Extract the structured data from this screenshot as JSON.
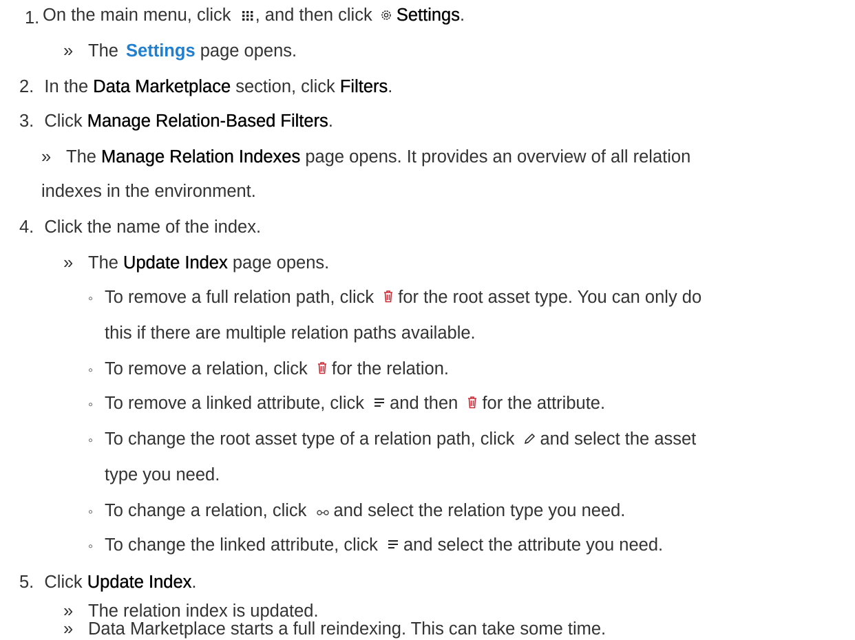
{
  "steps": [
    {
      "number": "1.",
      "text_a": "On the main menu, click",
      "text_b": ", and then click",
      "settings_label": "Settings",
      "period": ".",
      "result_marker": "»",
      "result_a": "The",
      "result_link": "Settings",
      "result_b": "page opens."
    },
    {
      "number": "2.",
      "text_a": "In the",
      "bold_1": "Data Marketplace",
      "text_b": "section, click",
      "bold_2": "Filters",
      "period": "."
    },
    {
      "number": "3.",
      "text_a": "Click",
      "bold_1": "Manage Relation-Based Filters",
      "period": ".",
      "result_marker": "»",
      "result_a": "The",
      "result_bold": "Manage Relation Indexes",
      "result_b": "page opens. It provides an overview of all relation",
      "result_c": "indexes in the environment."
    },
    {
      "number": "4.",
      "text_a": "Click the name of the index.",
      "result_marker": "»",
      "result_a": "The",
      "result_bold": "Update Index",
      "result_b": "page opens.",
      "bullet": "◦",
      "sub": [
        {
          "a": "To remove a full relation path, click",
          "b": "for the root asset type. You can only do",
          "c": "this if there are multiple relation paths available."
        },
        {
          "a": "To remove a relation, click",
          "b": "for the relation."
        },
        {
          "a": "To remove a linked attribute, click",
          "b": "and then",
          "c": "for the attribute."
        },
        {
          "a": "To change the root asset type of a relation path, click",
          "b": "and select the asset",
          "c": "type you need."
        },
        {
          "a": "To change a relation, click",
          "b": "and select the relation type you need."
        },
        {
          "a": "To change the linked attribute, click",
          "b": "and select the attribute you need."
        }
      ]
    },
    {
      "number": "5.",
      "text_a": "Click",
      "bold_1": "Update Index",
      "period": ".",
      "result_marker": "»",
      "result_1": "The relation index is updated.",
      "result_2": "Data Marketplace starts a full reindexing. This can take some time."
    }
  ],
  "icons": {
    "apps": "apps-grid-icon",
    "settings": "settings-gear-icon",
    "delete": "trash-icon",
    "attributes": "attribute-list-icon",
    "edit": "pencil-edit-icon",
    "relation": "relation-link-icon"
  },
  "colors": {
    "link": "#1f7fd1",
    "delete_icon": "#cc2a36"
  }
}
